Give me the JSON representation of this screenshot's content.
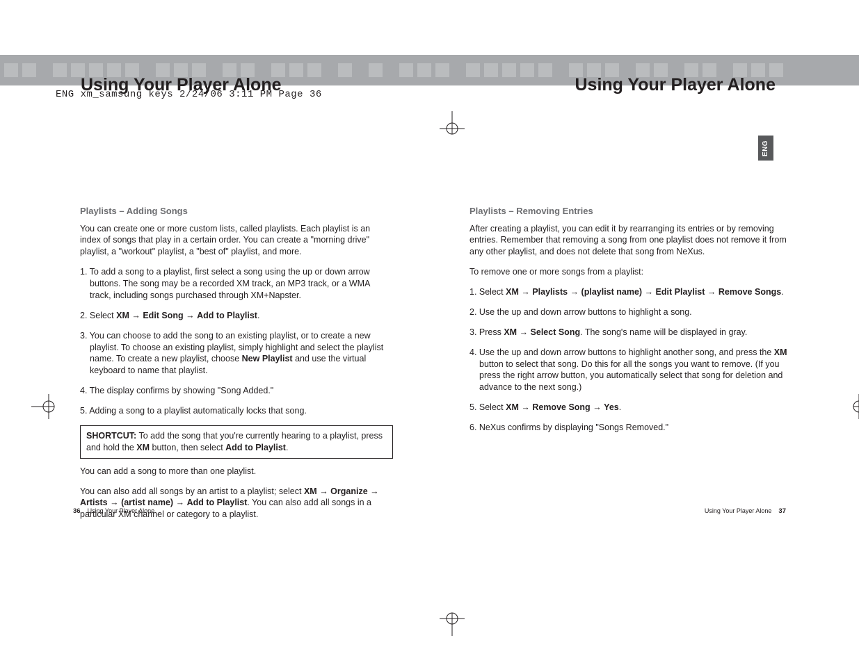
{
  "meta_line": "ENG xm_samsung keys  2/24/06  3:11 PM  Page 36",
  "header_title_left": "Using Your Player Alone",
  "header_title_right": "Using Your Player Alone",
  "lang_tab": "ENG",
  "arrow_glyph": "→",
  "left": {
    "subhead": "Playlists – Adding Songs",
    "intro": "You can create one or more custom lists, called playlists. Each playlist is an index of songs that play in a certain order. You can create a \"morning drive\" playlist, a \"workout\" playlist, a \"best of\" playlist, and more.",
    "steps": {
      "s1": "1. To add a song to a playlist, first select a song using the up or down arrow buttons. The song may be a recorded XM track, an MP3 track, or a WMA track, including songs purchased through XM+Napster.",
      "s2_prefix": "2. Select ",
      "s2_b1": "XM",
      "s2_b2": "Edit Song",
      "s2_b3": "Add to Playlist",
      "s3_pre": "3. You can choose to add the song to an existing playlist, or to create a new playlist. To choose an existing playlist, simply highlight and select the playlist name. To create a new playlist, choose ",
      "s3_b1": "New Playlist",
      "s3_post": " and use the virtual keyboard to name that playlist.",
      "s4": "4. The display confirms by showing \"Song Added.\"",
      "s5": "5. Adding a song to a playlist automatically locks that song."
    },
    "shortcut": {
      "label": "SHORTCUT:",
      "text_pre": " To add the song that you're currently hearing to a playlist, press and hold the ",
      "b1": "XM",
      "text_mid": " button, then select ",
      "b2": "Add to Playlist",
      "text_post": "."
    },
    "after1": "You can add a song to more than one playlist.",
    "after2_pre": "You can also add all songs by an artist to a playlist; select ",
    "after2_b1": "XM",
    "after2_b2": "Organize",
    "after2_b3": "Artists",
    "after2_b4": "(artist name)",
    "after2_b5": "Add to Playlist",
    "after2_post": ". You can also add all songs in a particular XM channel or category to a playlist."
  },
  "right": {
    "subhead": "Playlists – Removing Entries",
    "intro": "After creating a playlist, you can edit it by rearranging its entries or by removing entries. Remember that removing a song from one playlist does not remove it from any other playlist, and does not delete that song from NeXus.",
    "lead": "To remove one or more songs from a playlist:",
    "steps": {
      "s1_pre": "1. Select ",
      "s1_b1": "XM",
      "s1_b2": "Playlists",
      "s1_b3": "(playlist name)",
      "s1_b4": "Edit Playlist",
      "s1_b5": "Remove Songs",
      "s2": "2. Use the up and down arrow buttons to highlight a song.",
      "s3_pre": "3. Press ",
      "s3_b1": "XM",
      "s3_b2": "Select Song",
      "s3_post": ". The song's name will be displayed in gray.",
      "s4_pre": "4. Use the up and down arrow buttons to highlight another song, and press the ",
      "s4_b1": "XM",
      "s4_post": " button to select that song. Do this for all the songs you want to remove. (If you press the right arrow button, you automatically select that song for deletion and advance to the next song.)",
      "s5_pre": "5. Select ",
      "s5_b1": "XM",
      "s5_b2": "Remove Song",
      "s5_b3": "Yes",
      "s6": "6. NeXus confirms by displaying \"Songs Removed.\""
    }
  },
  "footer": {
    "left_num": "36",
    "left_text": "Using Your Player Alone",
    "right_text": "Using Your Player Alone",
    "right_num": "37"
  }
}
